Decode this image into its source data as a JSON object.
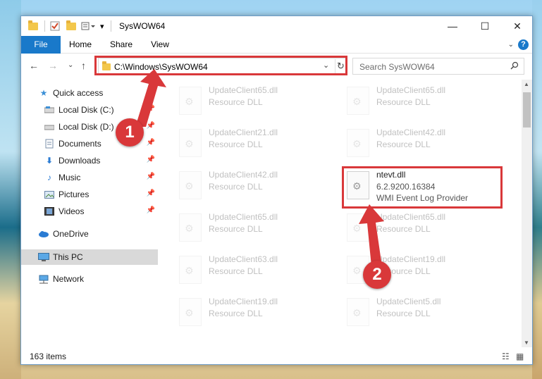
{
  "window": {
    "title": "SysWOW64",
    "controls": {
      "minimize": "—",
      "maximize": "☐",
      "close": "✕"
    }
  },
  "ribbon": {
    "tabs": [
      {
        "label": "File"
      },
      {
        "label": "Home"
      },
      {
        "label": "Share"
      },
      {
        "label": "View"
      }
    ],
    "help": "?"
  },
  "nav": {
    "address": "C:\\Windows\\SysWOW64",
    "search_placeholder": "Search SysWOW64"
  },
  "sidebar": {
    "items": [
      {
        "label": "Quick access",
        "icon": "star-icon",
        "pinned": false
      },
      {
        "label": "Local Disk (C:)",
        "icon": "drive-icon",
        "pinned": true
      },
      {
        "label": "Local Disk (D:)",
        "icon": "drive-icon",
        "pinned": true
      },
      {
        "label": "Documents",
        "icon": "documents-icon",
        "pinned": true
      },
      {
        "label": "Downloads",
        "icon": "download-icon",
        "pinned": true
      },
      {
        "label": "Music",
        "icon": "music-icon",
        "pinned": true
      },
      {
        "label": "Pictures",
        "icon": "pictures-icon",
        "pinned": true
      },
      {
        "label": "Videos",
        "icon": "videos-icon",
        "pinned": true
      },
      {
        "label": "OneDrive",
        "icon": "cloud-icon",
        "pinned": false
      },
      {
        "label": "This PC",
        "icon": "pc-icon",
        "pinned": false,
        "selected": true
      },
      {
        "label": "Network",
        "icon": "network-icon",
        "pinned": false
      }
    ]
  },
  "files": [
    {
      "name": "UpdateClient65.dll",
      "sub": "Resource DLL",
      "faded": true
    },
    {
      "name": "UpdateClient65.dll",
      "sub": "Resource DLL",
      "faded": true
    },
    {
      "name": "UpdateClient21.dll",
      "sub": "Resource DLL",
      "faded": true
    },
    {
      "name": "UpdateClient42.dll",
      "sub": "Resource DLL",
      "faded": true
    },
    {
      "name": "UpdateClient42.dll",
      "sub": "Resource DLL",
      "faded": true
    },
    {
      "name": "ntevt.dll",
      "sub": "6.2.9200.16384",
      "sub2": "WMI Event Log Provider",
      "faded": false
    },
    {
      "name": "UpdateClient65.dll",
      "sub": "Resource DLL",
      "faded": true
    },
    {
      "name": "UpdateClient65.dll",
      "sub": "Resource DLL",
      "faded": true
    },
    {
      "name": "UpdateClient63.dll",
      "sub": "Resource DLL",
      "faded": true
    },
    {
      "name": "UpdateClient19.dll",
      "sub": "Resource DLL",
      "faded": true
    },
    {
      "name": "UpdateClient19.dll",
      "sub": "Resource DLL",
      "faded": true
    },
    {
      "name": "UpdateClient5.dll",
      "sub": "Resource DLL",
      "faded": true
    }
  ],
  "status": {
    "count": "163 items"
  },
  "annotations": {
    "badge1": "1",
    "badge2": "2"
  },
  "colors": {
    "accent": "#1979ca",
    "highlight": "#d9383a"
  }
}
